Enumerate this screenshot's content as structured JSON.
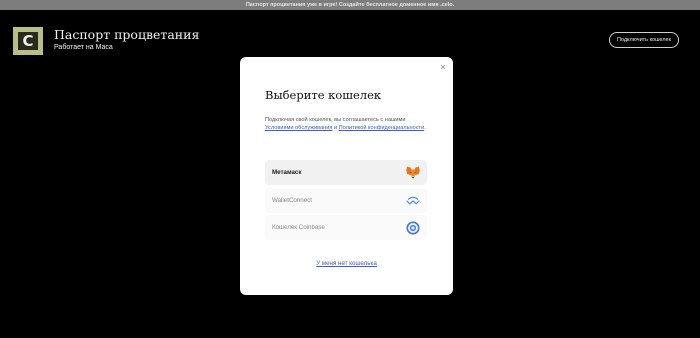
{
  "banner": {
    "text": "Паспорт процветания уже в игре! Создайте бесплатное доменное имя .celo."
  },
  "header": {
    "logo_letter": "C",
    "title": "Паспорт процветания",
    "subtitle": "Работает на Маса",
    "connect_label": "Подключить кошелек"
  },
  "modal": {
    "close": "×",
    "title": "Выберите кошелек",
    "desc_prefix": "Подключая свой кошелек, вы соглашаетесь с нашими",
    "terms_link": "Условиями обслуживания",
    "desc_and": "и",
    "privacy_link": "Политикой конфиденциальности",
    "desc_suffix": ".",
    "wallets": [
      {
        "label": "Метамаск",
        "icon": "metamask-fox-icon",
        "selected": true
      },
      {
        "label": "WalletConnect",
        "icon": "walletconnect-icon",
        "selected": false
      },
      {
        "label": "Кошелек Coinbase",
        "icon": "coinbase-icon",
        "selected": false
      }
    ],
    "no_wallet": "У меня нет кошелька"
  },
  "colors": {
    "background": "#000000",
    "banner": "#7d7d7d",
    "logo": "#b9bd86",
    "link": "#3a62c4"
  }
}
